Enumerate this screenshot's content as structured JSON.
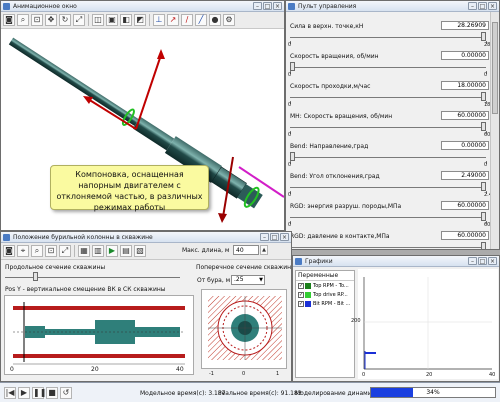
{
  "anim_window": {
    "title": "Анимационное окно",
    "caption": "Компоновка, оснащенная напорным двигателем с отклоняемой частью, в различных режимах работы"
  },
  "control_panel": {
    "title": "Пульт управления",
    "params": [
      {
        "label": "Сила в верхн. точке,кН",
        "value": "28.26909",
        "min": "0",
        "max": "28.27",
        "fraction": 1.0
      },
      {
        "label": "Скорость вращения, об/мин",
        "value": "0.00000",
        "min": "0",
        "max": "0",
        "fraction": 0.0
      },
      {
        "label": "Скорость проходки,м/час",
        "value": "18.00000",
        "min": "0",
        "max": "18",
        "fraction": 1.0
      },
      {
        "label": "МН: Скорость вращения, об/мин",
        "value": "60.00000",
        "min": "0",
        "max": "60",
        "fraction": 1.0
      },
      {
        "label": "Bend: Направление,град",
        "value": "0.00000",
        "min": "0",
        "max": "0",
        "fraction": 0.0
      },
      {
        "label": "Bend: Угол отклонения,град",
        "value": "2.49000",
        "min": "0",
        "max": "2.49",
        "fraction": 1.0
      },
      {
        "label": "RGD: энергия разруш. породы,МПа",
        "value": "60.00000",
        "min": "0",
        "max": "60",
        "fraction": 1.0
      },
      {
        "label": "RGD: давление в контакте,МПа",
        "value": "60.00000",
        "min": "0",
        "max": "60",
        "fraction": 1.0
      }
    ]
  },
  "position_window": {
    "title": "Положение бурильной колонны в скважине",
    "max_length_label": "Макс. длина, м",
    "max_length_value": "40",
    "cross_section_label": "Поперечное сечение скважины (вид св",
    "long_section_label": "Продольное сечение скважины",
    "distance_label": "От бура, м",
    "distance_value": ".25",
    "plot_title": "Pos Y - вертикальное смещение ВК в СК скважины",
    "x_ticks": [
      "0",
      "20",
      "40"
    ],
    "cross_ticks": [
      "-1",
      "0",
      "1"
    ]
  },
  "graphs_window": {
    "title": "Графики",
    "variables_header": "Переменные",
    "variables": [
      {
        "label": "Top RPM - To...",
        "color": "#1b7f1b"
      },
      {
        "label": "Top drive RP...",
        "color": "#33cc33"
      },
      {
        "label": "Bit RPM - Bit ...",
        "color": "#1a2fd6"
      }
    ],
    "y_tick": "200",
    "x_ticks": [
      "0",
      "20",
      "40"
    ]
  },
  "status_bar": {
    "model_time_label": "Модельное время(с): 3.187",
    "real_time_label": "Реальное время(с): 91.183",
    "progress_label": "Моделирование динамики:",
    "progress_value": "34%",
    "progress_fraction": 0.34
  }
}
